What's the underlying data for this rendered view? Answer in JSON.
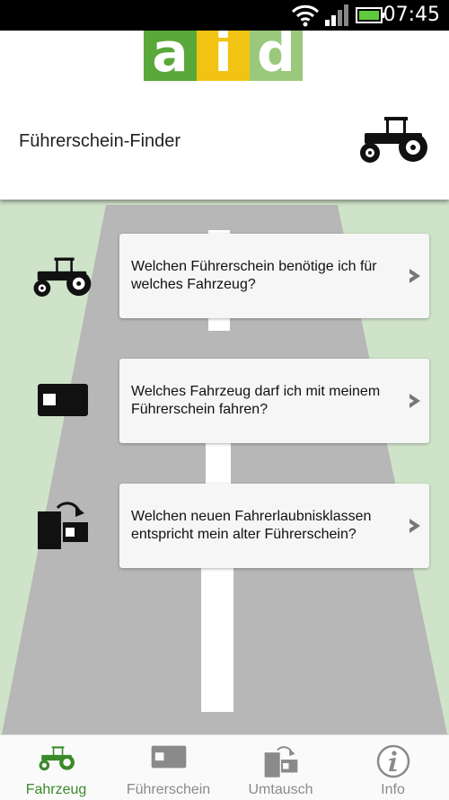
{
  "status_bar": {
    "time": "07:45"
  },
  "header": {
    "logo_letters": [
      "a",
      "i",
      "d"
    ],
    "title": "Führerschein-Finder"
  },
  "cards": [
    {
      "text": "Welchen Führerschein benötige ich für welches Fahrzeug?",
      "icon": "tractor-icon"
    },
    {
      "text": "Welches Fahrzeug darf ich mit meinem Führerschein fahren?",
      "icon": "license-card-icon"
    },
    {
      "text": "Welchen neuen Fahrerlaubnisklassen entspricht mein alter Führerschein?",
      "icon": "exchange-icon"
    }
  ],
  "tabs": [
    {
      "label": "Fahrzeug",
      "icon": "tractor-icon",
      "active": true
    },
    {
      "label": "Führerschein",
      "icon": "license-card-icon",
      "active": false
    },
    {
      "label": "Umtausch",
      "icon": "exchange-icon",
      "active": false
    },
    {
      "label": "Info",
      "icon": "info-icon",
      "active": false
    }
  ],
  "colors": {
    "accent": "#3a8a2a",
    "logo_green": "#5aa83a",
    "logo_yellow": "#f2c313",
    "logo_light_green": "#9ac97c",
    "background_green": "#cfe3c9",
    "road": "#b7b7b7"
  }
}
